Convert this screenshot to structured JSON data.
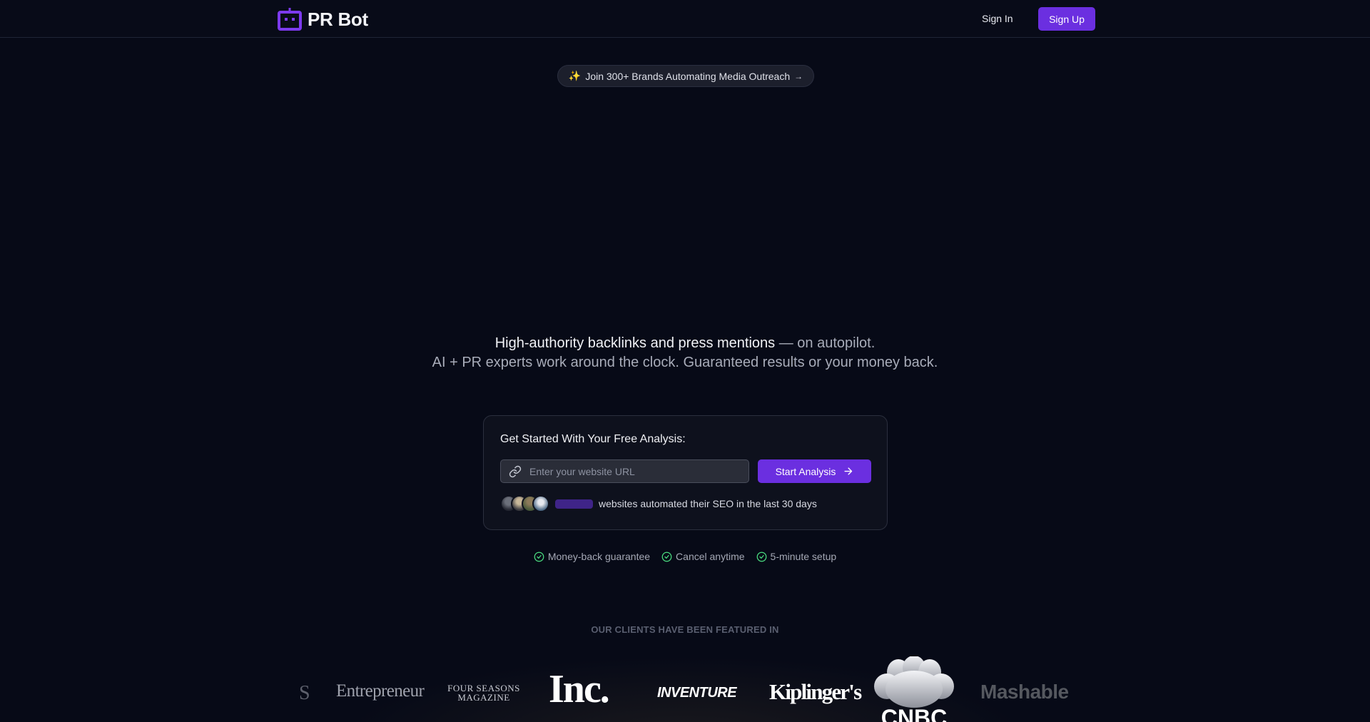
{
  "header": {
    "logo_text": "PR Bot",
    "sign_in": "Sign In",
    "sign_up": "Sign Up"
  },
  "announcement": {
    "emoji": "✨",
    "text": "Join 300+ Brands Automating Media Outreach",
    "arrow": "→"
  },
  "hero": {
    "line1_bright": "High-authority backlinks and press mentions",
    "line1_dim": " — on autopilot.",
    "line2": "AI + PR experts work around the clock. Guaranteed results or your money back."
  },
  "analysis_card": {
    "title": "Get Started With Your Free Analysis:",
    "url_placeholder": "Enter your website URL",
    "url_value": "",
    "button_label": "Start Analysis",
    "social_proof": "websites automated their SEO in the last 30 days"
  },
  "guarantees": [
    {
      "label": "Money-back guarantee",
      "icon": "check-circle-icon"
    },
    {
      "label": "Cancel anytime",
      "icon": "check-circle-icon"
    },
    {
      "label": "5-minute setup",
      "icon": "check-circle-icon"
    }
  ],
  "featured": {
    "label": "OUR CLIENTS HAVE BEEN FEATURED IN",
    "logos": {
      "partial": "S",
      "entrepreneur": "Entrepreneur",
      "four_seasons_1": "FOUR SEASONS",
      "four_seasons_2": "MAGAZINE",
      "inc": "Inc.",
      "inventure": "INVENTURE",
      "kiplingers": "Kiplinger's",
      "cnbc": "CNBC",
      "mashable": "Mashable"
    }
  },
  "colors": {
    "background": "#070a17",
    "accent": "#6b2fe0",
    "check": "#4ade80"
  }
}
